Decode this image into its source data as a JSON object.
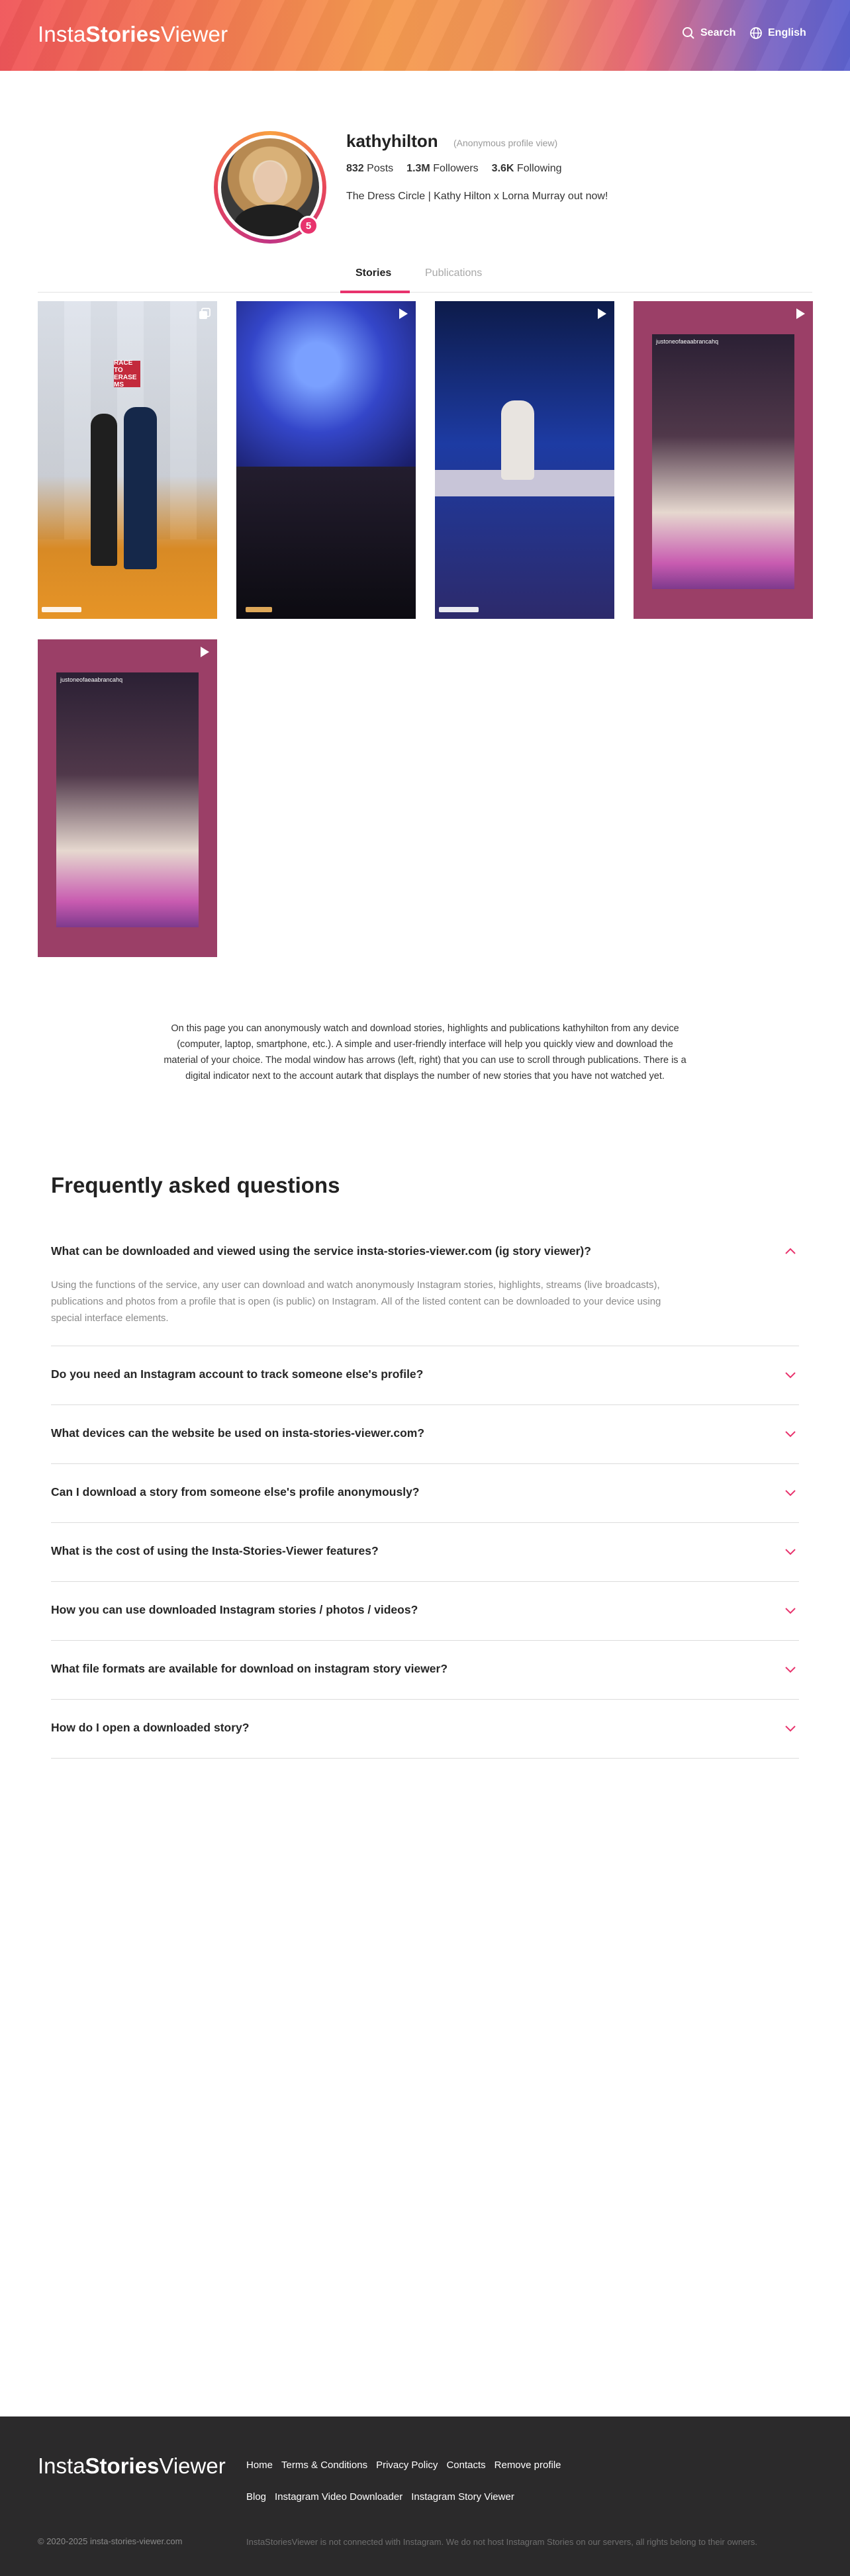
{
  "header": {
    "logo_prefix": "Insta",
    "logo_bold": "Stories",
    "logo_suffix": "Viewer",
    "search_label": "Search",
    "language_label": "English"
  },
  "profile": {
    "username": "kathyhilton",
    "view_mode": "(Anonymous profile view)",
    "stories_badge": "5",
    "posts_num": "832",
    "posts_label": "Posts",
    "followers_num": "1.3M",
    "followers_label": "Followers",
    "following_num": "3.6K",
    "following_label": "Following",
    "bio": "The Dress Circle | Kathy Hilton x Lorna Murray out now!"
  },
  "tabs": {
    "stories": "Stories",
    "publications": "Publications",
    "active": "stories"
  },
  "stories": [
    {
      "type": "carousel",
      "sign_text": "RACE TO ERASE MS"
    },
    {
      "type": "video"
    },
    {
      "type": "video"
    },
    {
      "type": "video",
      "overlay_user": "justoneofaeaabrancahq"
    },
    {
      "type": "video",
      "overlay_user": "justoneofaeaabrancahq"
    }
  ],
  "description": "On this page you can anonymously watch and download stories, highlights and publications kathyhilton from any device (computer, laptop, smartphone, etc.). A simple and user-friendly interface will help you quickly view and download the material of your choice. The modal window has arrows (left, right) that you can use to scroll through publications. There is a digital indicator next to the account autark that displays the number of new stories that you have not watched yet.",
  "faq": {
    "title": "Frequently asked questions",
    "items": [
      {
        "q": "What can be downloaded and viewed using the service insta-stories-viewer.com (ig story viewer)?",
        "a": "Using the functions of the service, any user can download and watch anonymously Instagram stories, highlights, streams (live broadcasts), publications and photos from a profile that is open (is public) on Instagram. All of the listed content can be downloaded to your device using special interface elements.",
        "open": true
      },
      {
        "q": "Do you need an Instagram account to track someone else's profile?",
        "open": false
      },
      {
        "q": "What devices can the website be used on insta-stories-viewer.com?",
        "open": false
      },
      {
        "q": "Can I download a story from someone else's profile anonymously?",
        "open": false
      },
      {
        "q": "What is the cost of using the Insta-Stories-Viewer features?",
        "open": false
      },
      {
        "q": "How you can use downloaded Instagram stories / photos / videos?",
        "open": false
      },
      {
        "q": "What file formats are available for download on instagram story viewer?",
        "open": false
      },
      {
        "q": "How do I open a downloaded story?",
        "open": false
      }
    ]
  },
  "footer": {
    "links_row1": [
      "Home",
      "Terms & Conditions",
      "Privacy Policy",
      "Contacts",
      "Remove profile"
    ],
    "links_row2": [
      "Blog",
      "Instagram Video Downloader",
      "Instagram Story Viewer"
    ],
    "copyright": "© 2020-2025 insta-stories-viewer.com",
    "disclaimer": "InstaStoriesViewer is not connected with Instagram. We do not host Instagram Stories on our servers, all rights belong to their owners."
  },
  "colors": {
    "accent": "#e8336d",
    "footer_bg": "#2b2a2b"
  }
}
